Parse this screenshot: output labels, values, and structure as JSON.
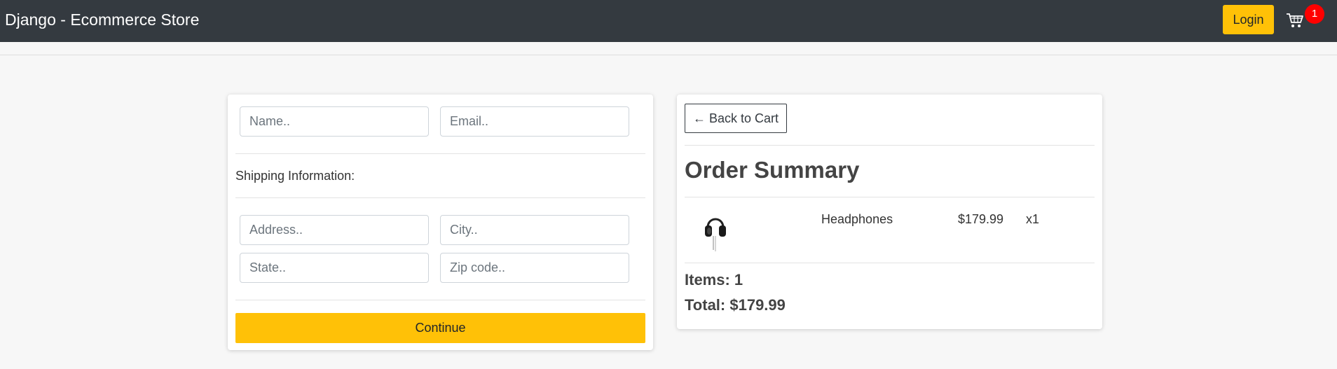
{
  "navbar": {
    "brand": "Django - Ecommerce Store",
    "login_label": "Login",
    "cart_icon": "cart-icon",
    "cart_count": "1",
    "badge_color": "#ff0000",
    "background": "#343a40"
  },
  "form": {
    "name_placeholder": "Name..",
    "email_placeholder": "Email..",
    "shipping_label": "Shipping Information:",
    "address_placeholder": "Address..",
    "city_placeholder": "City..",
    "state_placeholder": "State..",
    "zip_placeholder": "Zip code..",
    "continue_label": "Continue",
    "accent": "#ffc107"
  },
  "summary": {
    "back_label": "← Back to Cart",
    "title": "Order Summary",
    "items": [
      {
        "image_icon": "headphones-icon",
        "name": "Headphones",
        "price": "$179.99",
        "quantity": "x1"
      }
    ],
    "items_count": "Items: 1",
    "total": "Total: $179.99"
  }
}
